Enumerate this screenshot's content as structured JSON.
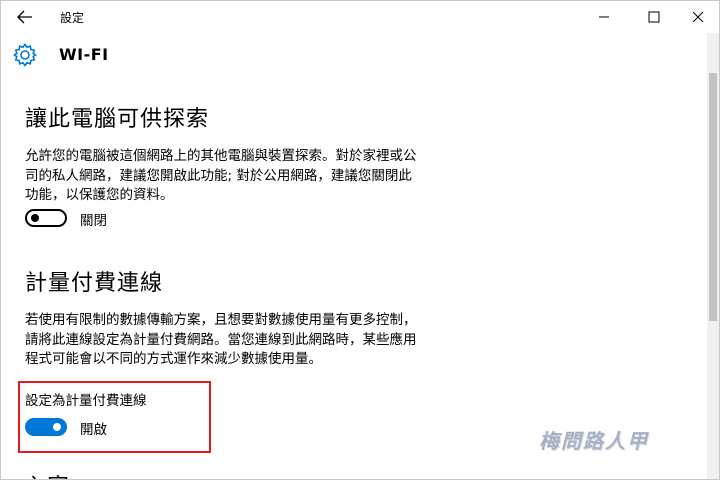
{
  "window": {
    "title": "設定",
    "controls": {
      "minimize": "minimize-icon",
      "maximize": "maximize-icon",
      "close": "close-icon"
    }
  },
  "header": {
    "icon": "gear-icon",
    "title": "WI-FI"
  },
  "discoverable": {
    "title": "讓此電腦可供探索",
    "description_lines": [
      "允許您的電腦被這個網路上的其他電腦與裝置探索。對於家裡或公",
      "司的私人網路，建議您開啟此功能; 對於公用網路，建議您關閉此",
      "功能，以保護您的資料。"
    ],
    "toggle_state": "off",
    "toggle_label": "關閉"
  },
  "metered": {
    "title": "計量付費連線",
    "description_lines": [
      "若使用有限制的數據傳輸方案，且想要對數據使用量有更多控制，",
      "請將此連線設定為計量付費網路。當您連線到此網路時，某些應用",
      "程式可能會以不同的方式運作來減少數據使用量。"
    ],
    "setting_label": "設定為計量付費連線",
    "toggle_state": "on",
    "toggle_label": "開啟"
  },
  "next_section_partial": "內容",
  "watermark": "梅問路人甲",
  "colors": {
    "accent": "#0078d7",
    "highlight": "#e31b1b"
  }
}
